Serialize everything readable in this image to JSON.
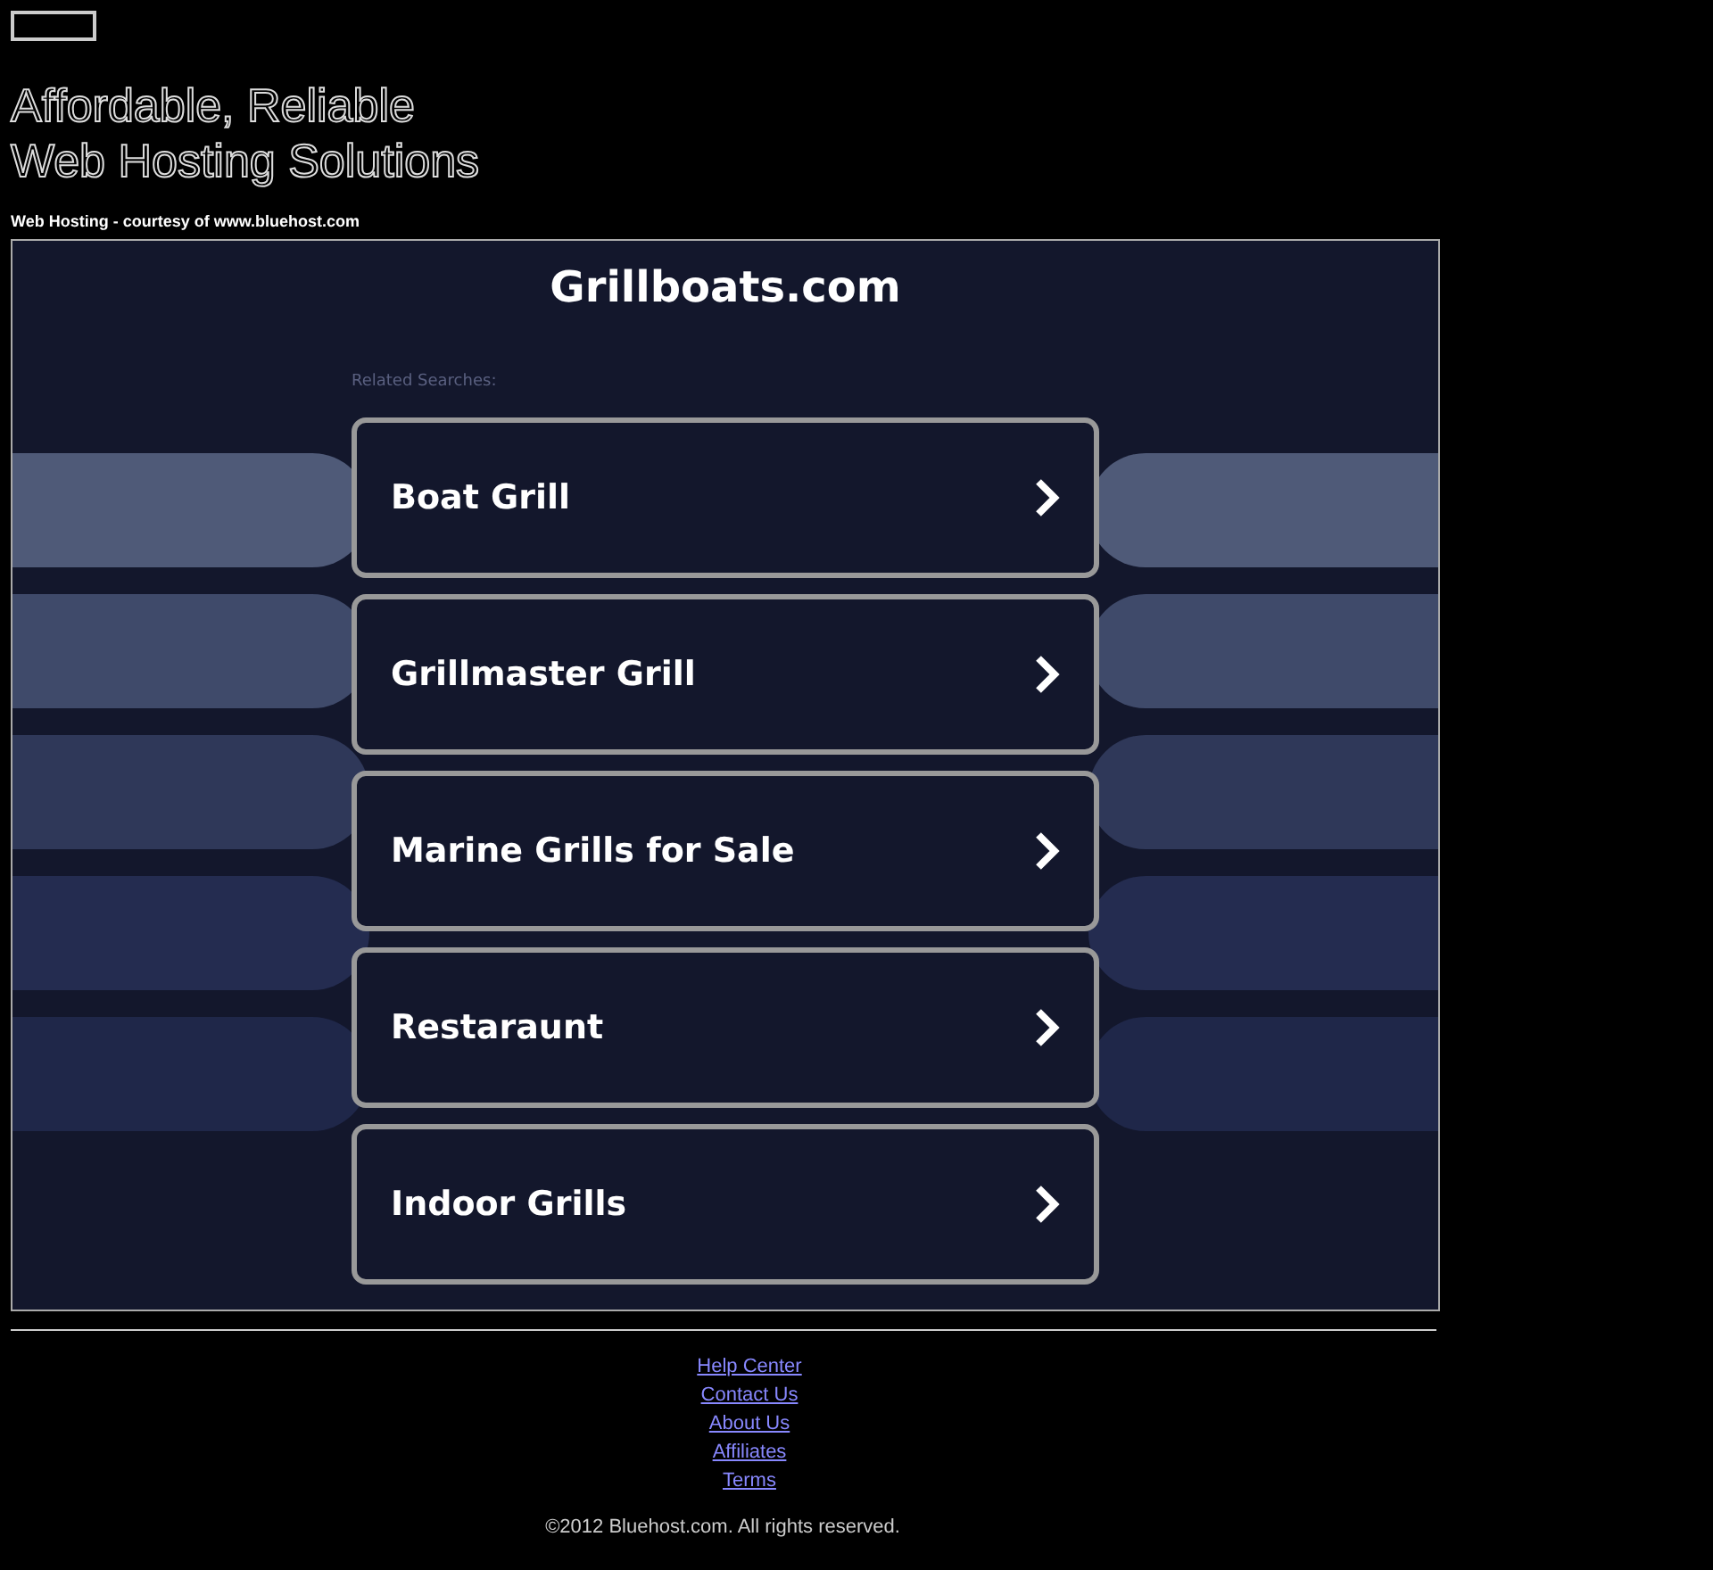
{
  "headline": [
    "Affordable, Reliable",
    "Web Hosting Solutions"
  ],
  "credit": "Web Hosting - courtesy of www.bluehost.com",
  "site": {
    "title": "Grillboats.com",
    "related_label": "Related Searches:",
    "searches": [
      {
        "label": "Boat Grill"
      },
      {
        "label": "Grillmaster Grill"
      },
      {
        "label": "Marine Grills for Sale"
      },
      {
        "label": "Restaraunt"
      },
      {
        "label": "Indoor Grills"
      }
    ]
  },
  "footer_links": [
    "Help Center",
    "Contact Us",
    "About Us",
    "Affiliates",
    "Terms"
  ],
  "copyright": "©2012 Bluehost.com. All rights reserved."
}
